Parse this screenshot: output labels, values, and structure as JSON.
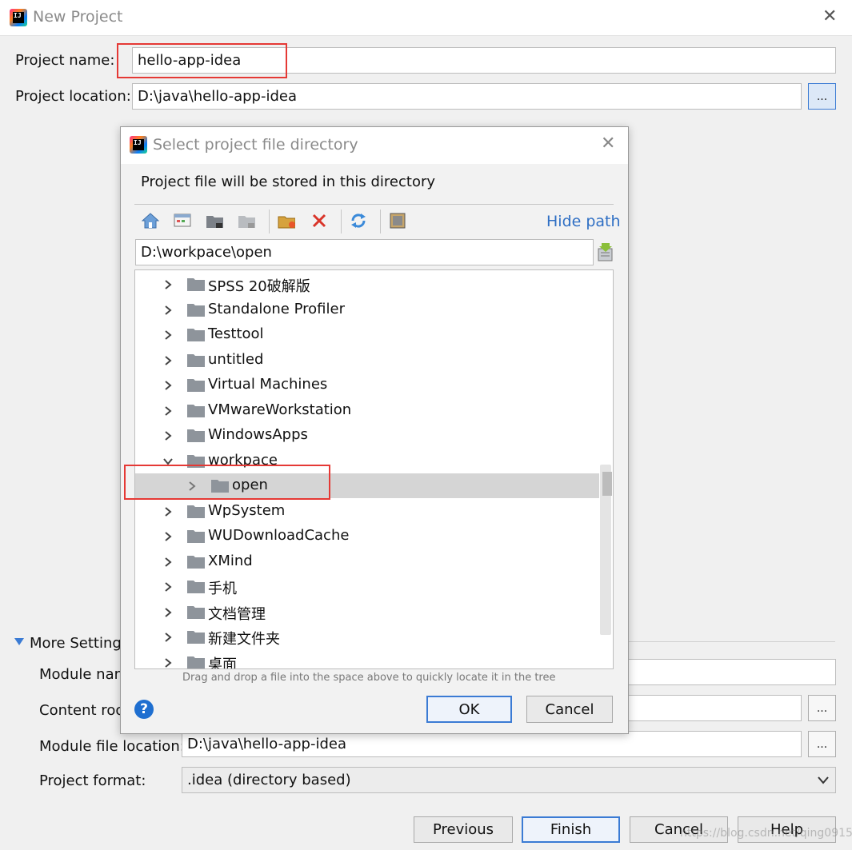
{
  "window": {
    "title": "New Project",
    "close_label": "✕"
  },
  "form": {
    "project_name_label": "Project name:",
    "project_name_value": "hello-app-idea",
    "project_location_label": "Project location:",
    "project_location_value": "D:\\java\\hello-app-idea",
    "browse_label": "...",
    "more_settings_label": "More Settings",
    "module_name_label": "Module nam",
    "content_root_label": "Content roo",
    "module_file_location_label": "Module file location:",
    "module_file_location_value": "D:\\java\\hello-app-idea",
    "project_format_label": "Project format:",
    "project_format_value": ".idea (directory based)"
  },
  "footer": {
    "previous": "Previous",
    "finish": "Finish",
    "cancel": "Cancel",
    "help": "Help",
    "watermark": "https://blog.csdn.net/qing0915"
  },
  "subdialog": {
    "title": "Select project file directory",
    "description": "Project file will be stored in this directory",
    "hide_path": "Hide path",
    "path_value": "D:\\workpace\\open",
    "hint": "Drag and drop a file into the space above to quickly locate it in the tree",
    "ok": "OK",
    "cancel": "Cancel",
    "help_glyph": "?",
    "tree": [
      {
        "name": "SPSS 20破解版",
        "expanded": false,
        "indent": 0
      },
      {
        "name": "Standalone Profiler",
        "expanded": false,
        "indent": 0
      },
      {
        "name": "Testtool",
        "expanded": false,
        "indent": 0
      },
      {
        "name": "untitled",
        "expanded": false,
        "indent": 0
      },
      {
        "name": "Virtual Machines",
        "expanded": false,
        "indent": 0
      },
      {
        "name": "VMwareWorkstation",
        "expanded": false,
        "indent": 0
      },
      {
        "name": "WindowsApps",
        "expanded": false,
        "indent": 0
      },
      {
        "name": "workpace",
        "expanded": true,
        "indent": 0
      },
      {
        "name": "open",
        "expanded": false,
        "indent": 1,
        "selected": true
      },
      {
        "name": "WpSystem",
        "expanded": false,
        "indent": 0
      },
      {
        "name": "WUDownloadCache",
        "expanded": false,
        "indent": 0
      },
      {
        "name": "XMind",
        "expanded": false,
        "indent": 0
      },
      {
        "name": "手机",
        "expanded": false,
        "indent": 0
      },
      {
        "name": "文档管理",
        "expanded": false,
        "indent": 0
      },
      {
        "name": "新建文件夹",
        "expanded": false,
        "indent": 0
      },
      {
        "name": "桌面",
        "expanded": false,
        "indent": 0
      }
    ]
  },
  "colors": {
    "accent": "#3b7bd4",
    "highlight_box": "#e53935",
    "selected_row": "#d5d5d5",
    "link": "#2f6fc4"
  }
}
